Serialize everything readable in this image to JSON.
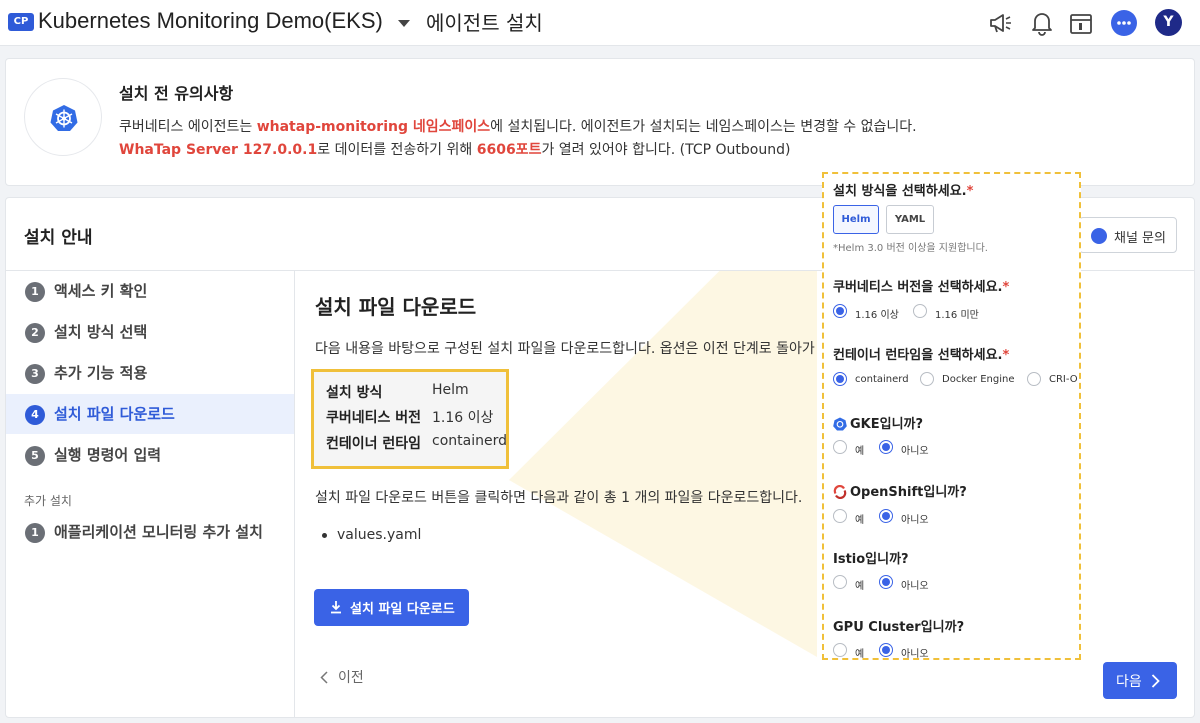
{
  "topbar": {
    "badge": "CP",
    "project_title": "Kubernetes Monitoring Demo(EKS)",
    "page_name": "에이전트 설치",
    "avatar_initial": "Y",
    "icons": [
      "megaphone-icon",
      "bell-icon",
      "news-icon",
      "chat-icon"
    ]
  },
  "notice": {
    "title": "설치 전 유의사항",
    "line1_a": "쿠버네티스 에이전트는 ",
    "line1_b": "whatap-monitoring 네임스페이스",
    "line1_c": "에 설치됩니다. 에이전트가 설치되는 네임스페이스는 변경할 수 없습니다.",
    "line2_a": "WhaTap Server 127.0.0.1",
    "line2_b": "로 데이터를 전송하기 위해 ",
    "line2_c": "6606포트",
    "line2_d": "가 열려 있어야 합니다. (TCP Outbound)"
  },
  "main": {
    "title": "설치 안내",
    "channel_button": "채널 문의",
    "steps": [
      {
        "num": "1",
        "label": "액세스 키 확인"
      },
      {
        "num": "2",
        "label": "설치 방식 선택"
      },
      {
        "num": "3",
        "label": "추가 기능 적용"
      },
      {
        "num": "4",
        "label": "설치 파일 다운로드"
      },
      {
        "num": "5",
        "label": "실행 명령어 입력"
      }
    ],
    "additional_header": "추가 설치",
    "additional_steps": [
      {
        "num": "1",
        "label": "애플리케이션 모니터링 추가 설치"
      }
    ],
    "content": {
      "title": "설치 파일 다운로드",
      "description": "다음 내용을 바탕으로 구성된 설치 파일을 다운로드합니다. 옵션은 이전 단계로 돌아가",
      "summary": [
        {
          "key": "설치 방식",
          "value": "Helm"
        },
        {
          "key": "쿠버네티스 버전",
          "value": "1.16 이상"
        },
        {
          "key": "컨테이너 런타임",
          "value": "containerd"
        }
      ],
      "description2": "설치 파일 다운로드 버튼을 클릭하면 다음과 같이 총 1 개의 파일을 다운로드합니다.",
      "files": [
        "values.yaml"
      ],
      "download_button": "설치 파일 다운로드",
      "prev_label": "이전",
      "next_label": "다음"
    }
  },
  "popup": {
    "install_method": {
      "question": "설치 방식을 선택하세요.",
      "required_mark": "*",
      "options": [
        "Helm",
        "YAML"
      ],
      "selected": "Helm",
      "hint": "*Helm 3.0 버전 이상을 지원합니다."
    },
    "k8s_version": {
      "question": "쿠버네티스 버전을 선택하세요.",
      "required_mark": "*",
      "options": [
        "1.16 이상",
        "1.16 미만"
      ],
      "selected": "1.16 이상"
    },
    "container_runtime": {
      "question": "컨테이너 런타임을 선택하세요.",
      "required_mark": "*",
      "options": [
        "containerd",
        "Docker Engine",
        "CRI-O"
      ],
      "selected": "containerd"
    },
    "gke": {
      "question": "GKE입니까?",
      "options": [
        "예",
        "아니오"
      ],
      "selected": "아니오"
    },
    "openshift": {
      "question": "OpenShift입니까?",
      "options": [
        "예",
        "아니오"
      ],
      "selected": "아니오"
    },
    "istio": {
      "question": "Istio입니까?",
      "options": [
        "예",
        "아니오"
      ],
      "selected": "아니오"
    },
    "gpu": {
      "question": "GPU Cluster입니까?",
      "options": [
        "예",
        "아니오"
      ],
      "selected": "아니오"
    }
  },
  "colors": {
    "accent": "#3a63e6",
    "highlight_red": "#e0463c",
    "callout_yellow": "#f0c03a"
  }
}
